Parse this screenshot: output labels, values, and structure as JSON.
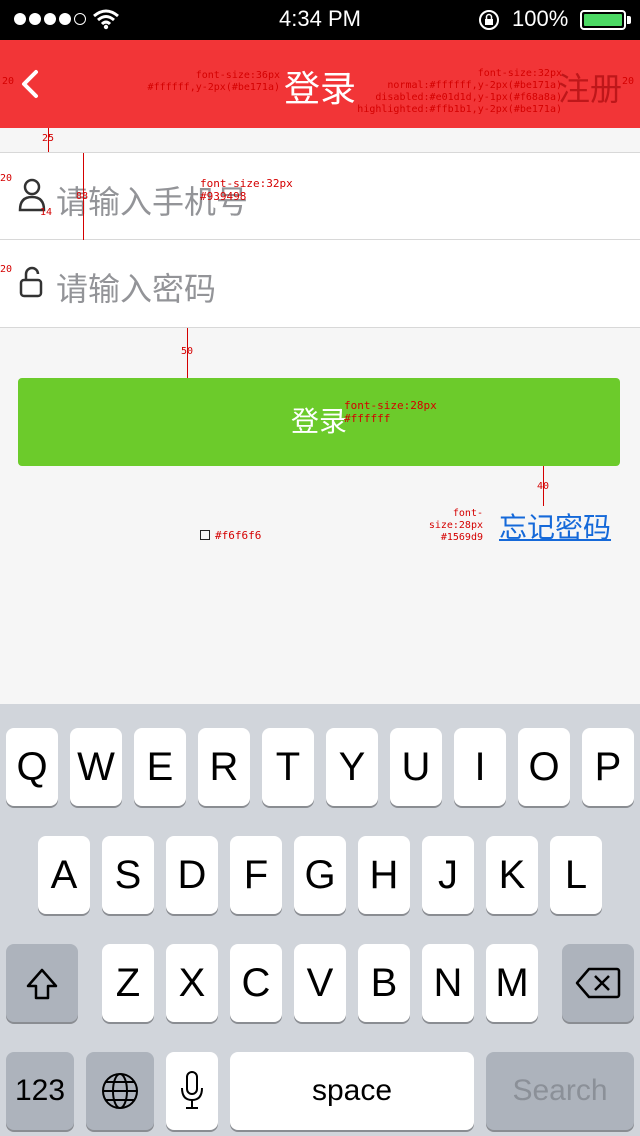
{
  "status_bar": {
    "time": "4:34 PM",
    "battery": "100%"
  },
  "nav": {
    "title": "登录",
    "right": "注册"
  },
  "annotations": {
    "title_spec": "font-size:36px\n#ffffff,y-2px(#be171a)",
    "right_spec": "font-size:32px\nnormal:#ffffff,y-2px(#be171a)\ndisabled:#e01d1d,y-1px(#f68a8a)\nhighlighted:#ffb1b1,y-2px(#be171a)",
    "input_spec": "font-size:32px\n#939498",
    "button_spec": "font-size:28px\n#ffffff",
    "forgot_spec": "font-size:28px\n#1569d9",
    "bg_spec": "#f6f6f6",
    "nav_left_margin": "20",
    "nav_right_margin": "20",
    "gap_top": "25",
    "row_height": "88",
    "left_pad_1": "20",
    "left_pad_2": "20",
    "icon_gap": "14",
    "gap_button": "50",
    "gap_forgot": "40"
  },
  "form": {
    "phone_placeholder": "请输入手机号",
    "password_placeholder": "请输入密码",
    "login_label": "登录",
    "forgot_label": "忘记密码"
  },
  "keyboard": {
    "row1": [
      "Q",
      "W",
      "E",
      "R",
      "T",
      "Y",
      "U",
      "I",
      "O",
      "P"
    ],
    "row2": [
      "A",
      "S",
      "D",
      "F",
      "G",
      "H",
      "J",
      "K",
      "L"
    ],
    "row3": [
      "Z",
      "X",
      "C",
      "V",
      "B",
      "N",
      "M"
    ],
    "numbers": "123",
    "space": "space",
    "search": "Search"
  },
  "colors": {
    "nav": "#f23537",
    "button": "#6ccb2b",
    "link": "#1569d9",
    "background": "#f6f6f6"
  }
}
